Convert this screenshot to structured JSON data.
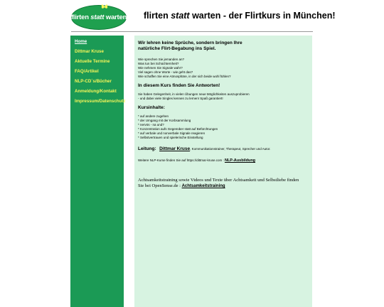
{
  "logo": {
    "text_pre": "flirten ",
    "text_mid": "statt",
    "text_post": " warten"
  },
  "header": {
    "title_pre": "flirten ",
    "title_em": "statt",
    "title_post": " warten - der Flirtkurs in München!"
  },
  "sidebar": {
    "items": [
      {
        "label": "Home"
      },
      {
        "label": "Dittmar Kruse"
      },
      {
        "label": "Aktuelle Termine"
      },
      {
        "label": "FAQ/Artikel"
      },
      {
        "label": "NLP-CD´s/Bücher"
      },
      {
        "label": "Anmeldung/Kontakt"
      },
      {
        "label": "Impressum/Datenschutz"
      }
    ]
  },
  "main": {
    "intro_heading_1": "Wir lehren keine Sprüche, sondern bringen Ihre",
    "intro_heading_2": "natürliche Flirt-Begabung ins Spiel.",
    "questions": [
      "Wie sprechen Sie jemanden an?",
      "Was tun bei Schüchternheit?",
      "Wie nehmen Sie Signale wahr?",
      "Viel sagen ohne Worte - wie geht das?",
      "Wie schaffen Sie eine Atmosphäre, in der sich beide wohl fühlen?"
    ],
    "answers_heading": "In diesem Kurs finden Sie Antworten!",
    "answers_text_1": "Sie haben Gelegenheit, in vielen Übungen neue Möglichkeiten auszuprobieren",
    "answers_text_2": "- und dabei viele Singles kennen zu lernen! Spaß garantiert!",
    "contents_heading": "Kursinhalte:",
    "contents": [
      "* auf andere zugehen",
      "* der Umgang mit der Korbsammlung",
      "* nervös - na und?",
      "* Konzentration aufs Gegenüber statt auf Befürchtungen",
      "* auf verbale und nonverbale Signale reagieren",
      "* Selbstvertrauen und spielerische Einstellung"
    ],
    "leitung_label": "Leitung:",
    "leitung_link": "Dittmar Kruse",
    "leitung_desc": ", Kommunikationstrainer, Therapeut, Sprecher und Autor.",
    "nlp_text": "Weitere NLP-Kurse finden Sie auf https://dittmar-kruse.com : ",
    "nlp_link": "NLP-Ausbildung",
    "achtsam_text_1": "Achtsamkeitstraining sowie Videos und Texte über Achtsamkeit und Selbstliebe finden",
    "achtsam_text_2": "Sie bei OpenSense.de : ",
    "achtsam_link": "Achtsamkeitstraining"
  },
  "colors": {
    "sidebar_bg": "#1b9a55",
    "nav_text": "#f5f55a",
    "content_bg": "#d7f3e1",
    "logo_bg": "#1fa04f"
  }
}
